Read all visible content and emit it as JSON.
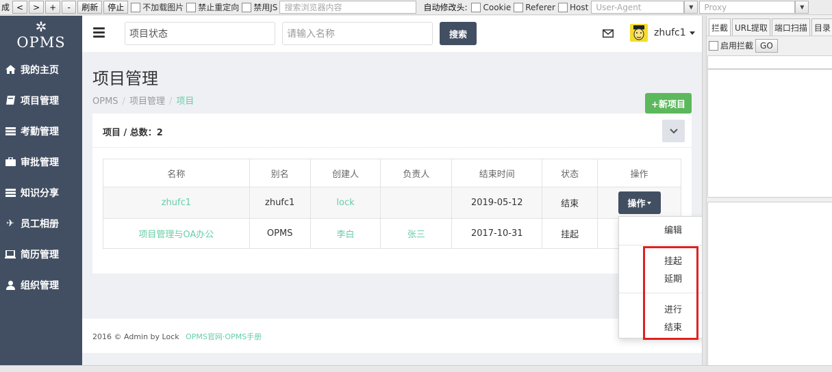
{
  "toolbar": {
    "left_text": "成",
    "back": "<",
    "forward": ">",
    "zoom_in": "+",
    "zoom_out": "-",
    "refresh": "刷新",
    "stop": "停止",
    "no_images": "不加载图片",
    "no_redirect": "禁止重定向",
    "disable_js": "禁用JS",
    "search_placeholder": "搜索浏览器内容",
    "auto_modify_header": "自动修改头:",
    "cookie": "Cookie",
    "referer": "Referer",
    "host": "Host",
    "user_agent_placeholder": "User-Agent",
    "proxy_placeholder": "Proxy"
  },
  "sidebar": {
    "logo_text": "OPMS",
    "items": [
      {
        "label": "我的主页",
        "icon": "home-icon"
      },
      {
        "label": "项目管理",
        "icon": "book-icon"
      },
      {
        "label": "考勤管理",
        "icon": "list-icon"
      },
      {
        "label": "审批管理",
        "icon": "briefcase-icon"
      },
      {
        "label": "知识分享",
        "icon": "list-icon"
      },
      {
        "label": "员工相册",
        "icon": "plane-icon"
      },
      {
        "label": "简历管理",
        "icon": "laptop-icon"
      },
      {
        "label": "组织管理",
        "icon": "user-icon"
      }
    ]
  },
  "header": {
    "status_value": "项目状态",
    "name_placeholder": "请输入名称",
    "search_label": "搜索",
    "username": "zhufc1"
  },
  "page": {
    "title": "项目管理",
    "breadcrumb": [
      "OPMS",
      "项目管理",
      "项目"
    ],
    "new_button": "+新项目",
    "panel_title": "项目 / 总数：2"
  },
  "table": {
    "columns": [
      "名称",
      "别名",
      "创建人",
      "负责人",
      "结束时间",
      "状态",
      "操作"
    ],
    "rows": [
      {
        "name": "zhufc1",
        "alias": "zhufc1",
        "creator": "lock",
        "owner": "",
        "end_date": "2019-05-12",
        "status": "结束",
        "action": "操作"
      },
      {
        "name": "项目管理与OA办公",
        "alias": "OPMS",
        "creator": "李白",
        "owner": "张三",
        "end_date": "2017-10-31",
        "status": "挂起",
        "action": ""
      }
    ]
  },
  "dropdown": {
    "items": [
      "编辑",
      "挂起",
      "延期",
      "进行",
      "结束"
    ]
  },
  "footer": {
    "text": "2016 © Admin by Lock",
    "link1": "OPMS官网",
    "dot": "·",
    "link2": "OPMS手册"
  },
  "right_panel": {
    "tabs": [
      "拦截",
      "URL提取",
      "端口扫描",
      "目录"
    ],
    "enable_intercept": "启用拦截",
    "go": "GO"
  },
  "colors": {
    "sidebar_bg": "#424f63",
    "accent_green": "#65cea7",
    "new_button_green": "#5cb85c",
    "highlight_red": "#e02020"
  }
}
